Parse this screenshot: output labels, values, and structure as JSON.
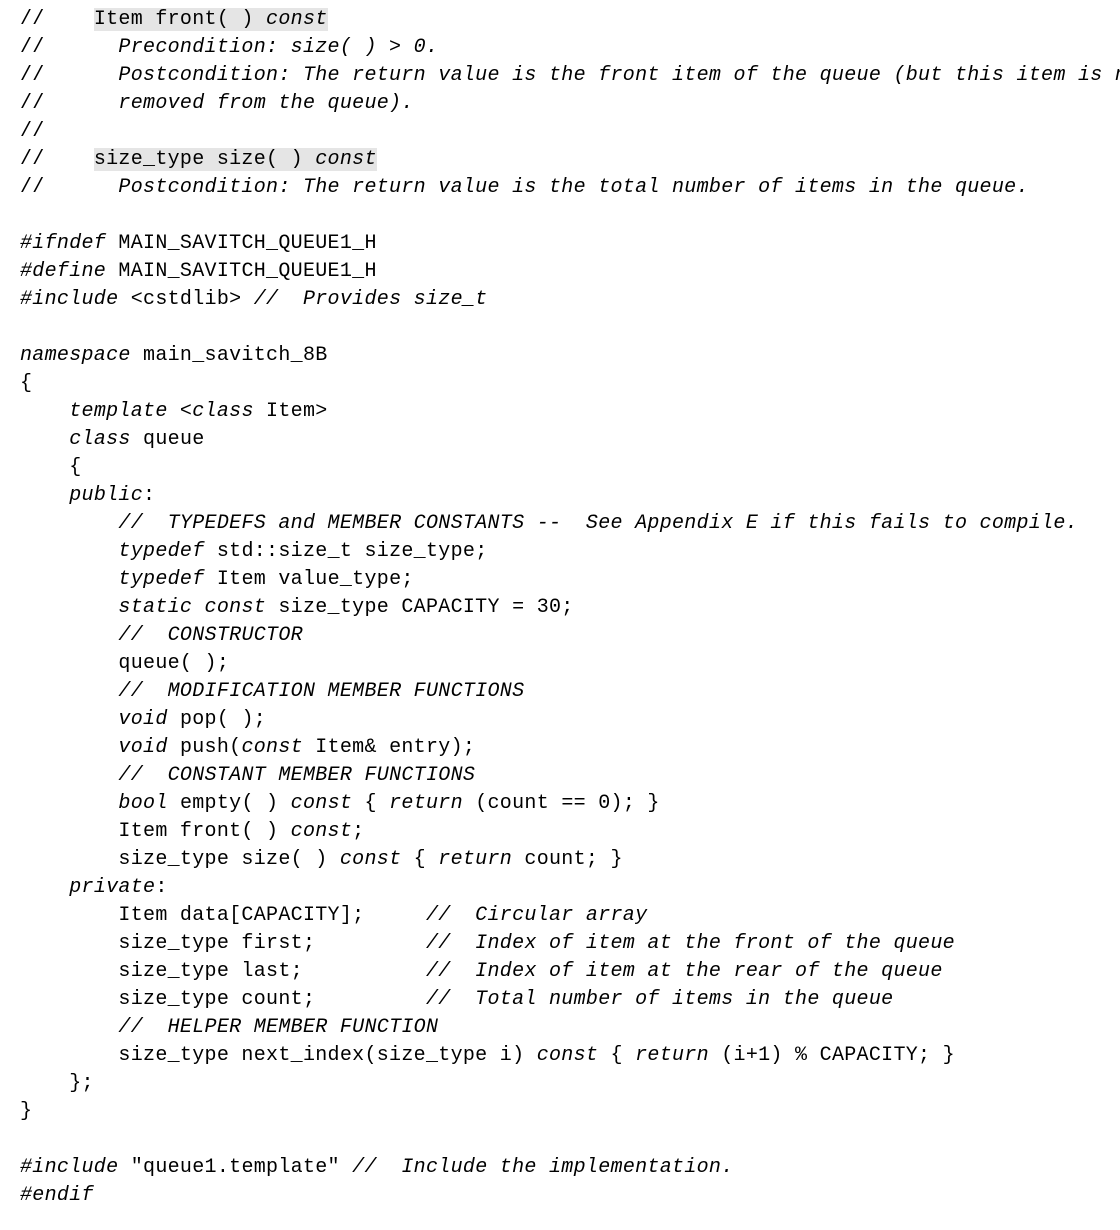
{
  "lines": [
    {
      "segments": [
        {
          "t": "// ",
          "s": "mono"
        },
        {
          "t": "   ",
          "s": "mono"
        },
        {
          "t": "Item front( ) ",
          "s": "mono hl"
        },
        {
          "t": "const",
          "s": "it hl"
        }
      ]
    },
    {
      "segments": [
        {
          "t": "// ",
          "s": "mono"
        },
        {
          "t": "     Precondition: size( ) > 0.",
          "s": "it"
        }
      ]
    },
    {
      "segments": [
        {
          "t": "// ",
          "s": "mono"
        },
        {
          "t": "     Postcondition: The return value is the front item of the queue (but this item is not",
          "s": "it"
        }
      ]
    },
    {
      "segments": [
        {
          "t": "// ",
          "s": "mono"
        },
        {
          "t": "     removed from the queue).",
          "s": "it"
        }
      ]
    },
    {
      "segments": [
        {
          "t": "//",
          "s": "mono"
        }
      ]
    },
    {
      "segments": [
        {
          "t": "// ",
          "s": "mono"
        },
        {
          "t": "   ",
          "s": "mono"
        },
        {
          "t": "size_type size( ) ",
          "s": "mono hl"
        },
        {
          "t": "const",
          "s": "it hl"
        }
      ]
    },
    {
      "segments": [
        {
          "t": "// ",
          "s": "mono"
        },
        {
          "t": "     Postcondition: The return value is the total number of items in the queue.",
          "s": "it"
        }
      ]
    },
    {
      "segments": [
        {
          "t": "",
          "s": "mono"
        }
      ]
    },
    {
      "segments": [
        {
          "t": "#ifndef",
          "s": "it"
        },
        {
          "t": " MAIN_SAVITCH_QUEUE1_H",
          "s": "mono"
        }
      ]
    },
    {
      "segments": [
        {
          "t": "#define",
          "s": "it"
        },
        {
          "t": " MAIN_SAVITCH_QUEUE1_H",
          "s": "mono"
        }
      ]
    },
    {
      "segments": [
        {
          "t": "#include",
          "s": "it"
        },
        {
          "t": " <cstdlib> ",
          "s": "mono"
        },
        {
          "t": "//  Provides size_t",
          "s": "it"
        }
      ]
    },
    {
      "segments": [
        {
          "t": "",
          "s": "mono"
        }
      ]
    },
    {
      "segments": [
        {
          "t": "namespace",
          "s": "it"
        },
        {
          "t": " main_savitch_8B",
          "s": "mono"
        }
      ]
    },
    {
      "segments": [
        {
          "t": "{",
          "s": "mono"
        }
      ]
    },
    {
      "segments": [
        {
          "t": "    ",
          "s": "mono"
        },
        {
          "t": "template <class",
          "s": "it"
        },
        {
          "t": " Item>",
          "s": "mono"
        }
      ]
    },
    {
      "segments": [
        {
          "t": "    ",
          "s": "mono"
        },
        {
          "t": "class",
          "s": "it"
        },
        {
          "t": " queue",
          "s": "mono"
        }
      ]
    },
    {
      "segments": [
        {
          "t": "    {",
          "s": "mono"
        }
      ]
    },
    {
      "segments": [
        {
          "t": "    ",
          "s": "mono"
        },
        {
          "t": "public",
          "s": "it"
        },
        {
          "t": ":",
          "s": "mono"
        }
      ]
    },
    {
      "segments": [
        {
          "t": "        ",
          "s": "mono"
        },
        {
          "t": "//  TYPEDEFS and MEMBER CONSTANTS --  See Appendix E if this fails to compile.",
          "s": "it"
        }
      ]
    },
    {
      "segments": [
        {
          "t": "        ",
          "s": "mono"
        },
        {
          "t": "typedef",
          "s": "it"
        },
        {
          "t": " std::size_t size_type;",
          "s": "mono"
        }
      ]
    },
    {
      "segments": [
        {
          "t": "        ",
          "s": "mono"
        },
        {
          "t": "typedef",
          "s": "it"
        },
        {
          "t": " Item value_type;",
          "s": "mono"
        }
      ]
    },
    {
      "segments": [
        {
          "t": "        ",
          "s": "mono"
        },
        {
          "t": "static const",
          "s": "it"
        },
        {
          "t": " size_type CAPACITY = 30;",
          "s": "mono"
        }
      ]
    },
    {
      "segments": [
        {
          "t": "        ",
          "s": "mono"
        },
        {
          "t": "//  CONSTRUCTOR",
          "s": "it"
        }
      ]
    },
    {
      "segments": [
        {
          "t": "        queue( );",
          "s": "mono"
        }
      ]
    },
    {
      "segments": [
        {
          "t": "        ",
          "s": "mono"
        },
        {
          "t": "//  MODIFICATION MEMBER FUNCTIONS",
          "s": "it"
        }
      ]
    },
    {
      "segments": [
        {
          "t": "        ",
          "s": "mono"
        },
        {
          "t": "void",
          "s": "it"
        },
        {
          "t": " pop( );",
          "s": "mono"
        }
      ]
    },
    {
      "segments": [
        {
          "t": "        ",
          "s": "mono"
        },
        {
          "t": "void",
          "s": "it"
        },
        {
          "t": " push(",
          "s": "mono"
        },
        {
          "t": "const",
          "s": "it"
        },
        {
          "t": " Item& entry);",
          "s": "mono"
        }
      ]
    },
    {
      "segments": [
        {
          "t": "        ",
          "s": "mono"
        },
        {
          "t": "//  CONSTANT MEMBER FUNCTIONS",
          "s": "it"
        }
      ]
    },
    {
      "segments": [
        {
          "t": "        ",
          "s": "mono"
        },
        {
          "t": "bool",
          "s": "it"
        },
        {
          "t": " empty( ) ",
          "s": "mono"
        },
        {
          "t": "const",
          "s": "it"
        },
        {
          "t": " { ",
          "s": "mono"
        },
        {
          "t": "return",
          "s": "it"
        },
        {
          "t": " (count == 0); }",
          "s": "mono"
        }
      ]
    },
    {
      "segments": [
        {
          "t": "        Item front( ) ",
          "s": "mono"
        },
        {
          "t": "const",
          "s": "it"
        },
        {
          "t": ";",
          "s": "mono"
        }
      ]
    },
    {
      "segments": [
        {
          "t": "        size_type size( ) ",
          "s": "mono"
        },
        {
          "t": "const",
          "s": "it"
        },
        {
          "t": " { ",
          "s": "mono"
        },
        {
          "t": "return",
          "s": "it"
        },
        {
          "t": " count; }",
          "s": "mono"
        }
      ]
    },
    {
      "segments": [
        {
          "t": "    ",
          "s": "mono"
        },
        {
          "t": "private",
          "s": "it"
        },
        {
          "t": ":",
          "s": "mono"
        }
      ]
    },
    {
      "segments": [
        {
          "t": "        Item data[CAPACITY];     ",
          "s": "mono"
        },
        {
          "t": "//  Circular array",
          "s": "it"
        }
      ]
    },
    {
      "segments": [
        {
          "t": "        size_type first;         ",
          "s": "mono"
        },
        {
          "t": "//  Index of item at the front of the queue",
          "s": "it"
        }
      ]
    },
    {
      "segments": [
        {
          "t": "        size_type last;          ",
          "s": "mono"
        },
        {
          "t": "//  Index of item at the rear of the queue",
          "s": "it"
        }
      ]
    },
    {
      "segments": [
        {
          "t": "        size_type count;         ",
          "s": "mono"
        },
        {
          "t": "//  Total number of items in the queue",
          "s": "it"
        }
      ]
    },
    {
      "segments": [
        {
          "t": "        ",
          "s": "mono"
        },
        {
          "t": "//  HELPER MEMBER FUNCTION",
          "s": "it"
        }
      ]
    },
    {
      "segments": [
        {
          "t": "        size_type next_index(size_type i) ",
          "s": "mono"
        },
        {
          "t": "const",
          "s": "it"
        },
        {
          "t": " { ",
          "s": "mono"
        },
        {
          "t": "return",
          "s": "it"
        },
        {
          "t": " (i+1) % CAPACITY; }",
          "s": "mono"
        }
      ]
    },
    {
      "segments": [
        {
          "t": "    };",
          "s": "mono"
        }
      ]
    },
    {
      "segments": [
        {
          "t": "}",
          "s": "mono"
        }
      ]
    },
    {
      "segments": [
        {
          "t": "",
          "s": "mono"
        }
      ]
    },
    {
      "segments": [
        {
          "t": "#include",
          "s": "it"
        },
        {
          "t": " \"queue1.template\" ",
          "s": "mono"
        },
        {
          "t": "//  Include the implementation.",
          "s": "it"
        }
      ]
    },
    {
      "segments": [
        {
          "t": "#endif",
          "s": "it"
        }
      ]
    }
  ]
}
